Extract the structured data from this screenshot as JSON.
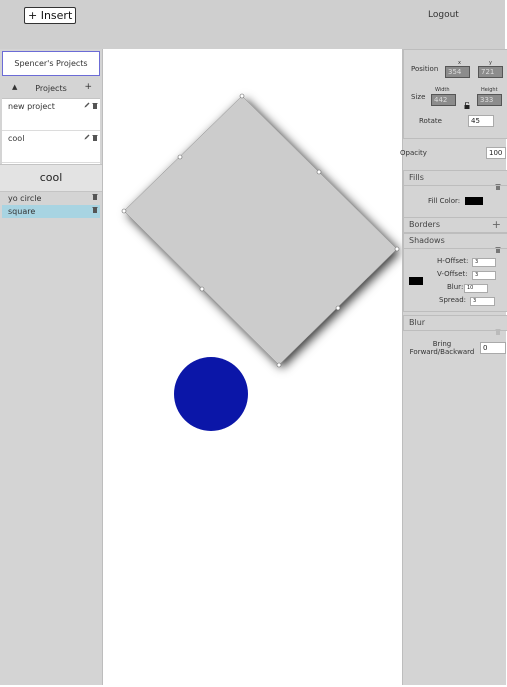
{
  "toolbar": {
    "insert_label": "+ Insert",
    "logout_label": "Logout"
  },
  "sidebar": {
    "owner": "Spencer's Projects",
    "projects_label": "Projects",
    "up_icon": "▲",
    "add_icon": "+",
    "projects": [
      {
        "name": "new project"
      },
      {
        "name": "cool"
      }
    ],
    "current_project": "cool",
    "layers": [
      {
        "name": "yo circle",
        "selected": false
      },
      {
        "name": "square",
        "selected": true
      }
    ]
  },
  "canvas": {
    "shapes": [
      {
        "name": "square",
        "type": "rectangle",
        "fill": "#cccccc",
        "rotate": 45
      },
      {
        "name": "yo circle",
        "type": "circle",
        "fill": "#0b16a8"
      }
    ]
  },
  "properties": {
    "position_label": "Position",
    "x_label": "x",
    "y_label": "y",
    "x_value": "354",
    "y_value": "721",
    "size_label": "Size",
    "width_label": "Width",
    "height_label": "Height",
    "width_value": "442",
    "height_value": "333",
    "rotate_label": "Rotate",
    "rotate_value": "45",
    "opacity_label": "Opacity",
    "opacity_value": "100",
    "fills_label": "Fills",
    "fill_color_label": "Fill Color:",
    "fill_color": "#000000",
    "borders_label": "Borders",
    "borders_add": "+",
    "shadows_label": "Shadows",
    "shadow_color": "#000000",
    "h_offset_label": "H-Offset:",
    "h_offset_value": "3",
    "v_offset_label": "V-Offset:",
    "v_offset_value": "3",
    "blur_label": "Blur:",
    "blur_value": "10",
    "spread_label": "Spread:",
    "spread_value": "3",
    "blur_section_label": "Blur",
    "order_label": "Bring Forward/Backward",
    "order_value": "0"
  },
  "icons": {
    "edit": "pencil-icon",
    "trash": "trash-icon",
    "link": "link-icon"
  }
}
